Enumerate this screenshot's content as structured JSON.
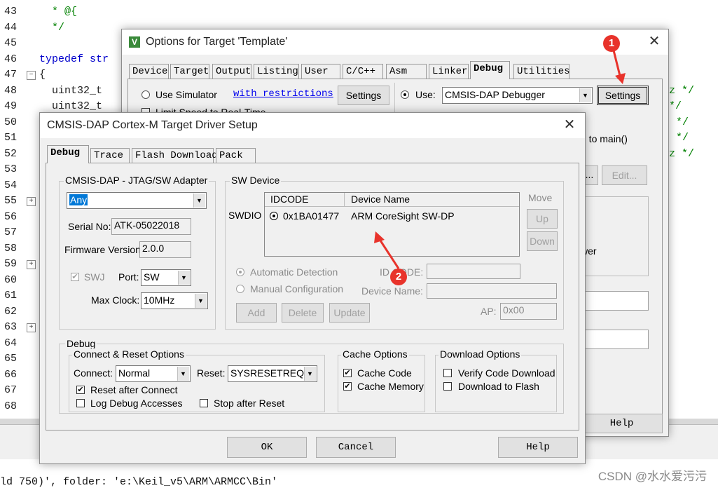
{
  "editor": {
    "line_numbers": [
      "43",
      "44",
      "45",
      "46",
      "47",
      "48",
      "49",
      "50",
      "51",
      "52",
      "53",
      "54",
      "55",
      "56",
      "57",
      "58",
      "59",
      "60",
      "61",
      "62",
      "63",
      "64",
      "65",
      "66",
      "67",
      "68"
    ],
    "code_lines": [
      {
        "line": "43",
        "text": "  * @{"
      },
      {
        "line": "44",
        "text": "  */"
      },
      {
        "line": "46",
        "kw": "typedef",
        "text": " str"
      },
      {
        "line": "47",
        "text": "{"
      },
      {
        "line": "48",
        "text": "  uint32_t"
      },
      {
        "line": "49",
        "text": "  uint32_t"
      }
    ],
    "right_comments": [
      "z */",
      "*/",
      "*/",
      "*/",
      "z */"
    ],
    "build_output": "ld 750)', folder: 'e:\\Keil_v5\\ARM\\ARMCC\\Bin'"
  },
  "watermark": "CSDN @水水爱污污",
  "options_dialog": {
    "title": "Options for Target 'Template'",
    "app_icon": "keil-uvision-icon",
    "tabs": [
      "Device",
      "Target",
      "Output",
      "Listing",
      "User",
      "C/C++",
      "Asm",
      "Linker",
      "Debug",
      "Utilities"
    ],
    "active_tab": "Debug",
    "use_simulator_label": "Use Simulator",
    "with_restrictions_link": "with restrictions",
    "settings_label": "Settings",
    "limit_speed_label": "Limit Speed to Real-Time",
    "use_label": "Use:",
    "debugger_value": "CMSIS-DAP Debugger",
    "run_to_main_text": "n to main()",
    "browse_label": "...",
    "edit_label": "Edit...",
    "power_text": "wer",
    "help_label": "Help"
  },
  "driver_dialog": {
    "title": "CMSIS-DAP Cortex-M Target Driver Setup",
    "tabs": [
      "Debug",
      "Trace",
      "Flash Download",
      "Pack"
    ],
    "active_tab": "Debug",
    "adapter_group": "CMSIS-DAP - JTAG/SW Adapter",
    "adapter_value": "Any",
    "serial_label": "Serial No:",
    "serial_value": "ATK-05022018",
    "firmware_label": "Firmware Version:",
    "firmware_value": "2.0.0",
    "swj_label": "SWJ",
    "port_label": "Port:",
    "port_value": "SW",
    "max_clock_label": "Max Clock:",
    "max_clock_value": "10MHz",
    "sw_device_group": "SW Device",
    "swdio_label": "SWDIO",
    "table_headers": [
      "IDCODE",
      "Device Name"
    ],
    "table_rows": [
      {
        "idcode": "0x1BA01477",
        "device_name": "ARM CoreSight SW-DP"
      }
    ],
    "move_label": "Move",
    "up_label": "Up",
    "down_label": "Down",
    "auto_detect_label": "Automatic Detection",
    "manual_config_label": "Manual Configuration",
    "id_code_label": "ID CODE:",
    "device_name_label": "Device Name:",
    "add_label": "Add",
    "delete_label": "Delete",
    "update_label": "Update",
    "ap_label": "AP:",
    "ap_value": "0x00",
    "debug_group": "Debug",
    "connect_reset_group": "Connect & Reset Options",
    "connect_label": "Connect:",
    "connect_value": "Normal",
    "reset_label": "Reset:",
    "reset_value": "SYSRESETREQ",
    "reset_after_connect_label": "Reset after Connect",
    "log_debug_label": "Log Debug Accesses",
    "stop_after_reset_label": "Stop after Reset",
    "cache_group": "Cache Options",
    "cache_code_label": "Cache Code",
    "cache_memory_label": "Cache Memory",
    "download_group": "Download Options",
    "verify_download_label": "Verify Code Download",
    "download_flash_label": "Download to Flash",
    "ok_label": "OK",
    "cancel_label": "Cancel",
    "help_label": "Help"
  },
  "annotations": {
    "marker_1": "1",
    "marker_2": "2",
    "color": "#e8332b"
  }
}
